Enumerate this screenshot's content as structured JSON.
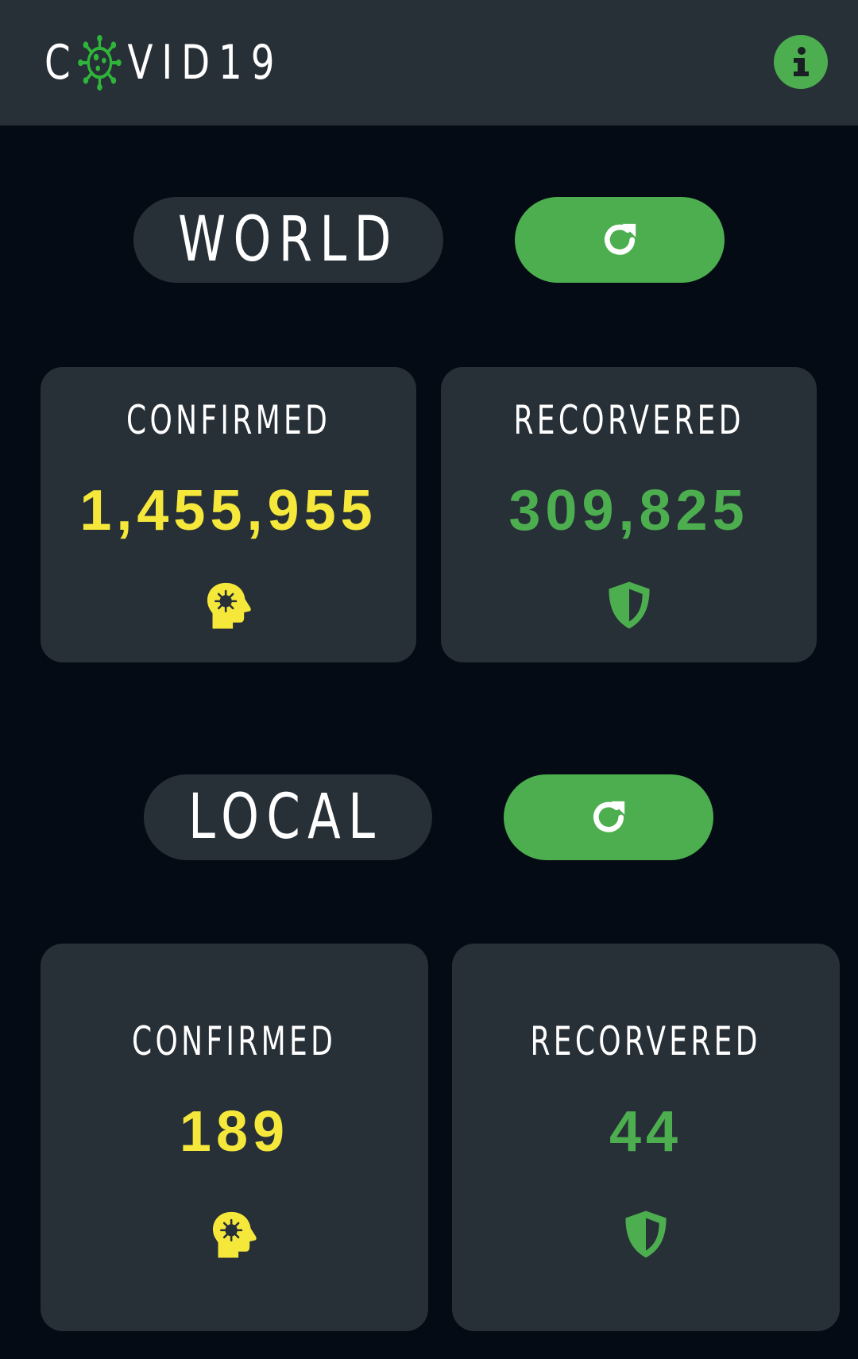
{
  "header": {
    "logo_left": "C",
    "logo_right": "VID19",
    "logo_icon": "virus-icon",
    "info_icon": "info-icon"
  },
  "world": {
    "label": "WORLD",
    "icon": "globe-icon",
    "refresh_icon": "refresh-icon",
    "confirmed": {
      "title": "CONFIRMED",
      "value": "1,455,955",
      "icon": "head-virus-icon"
    },
    "recovered": {
      "title": "RECORVERED",
      "value": "309,825",
      "icon": "shield-icon"
    }
  },
  "local": {
    "label": "LOCAL",
    "icon": "sri-lanka-flag-icon",
    "refresh_icon": "refresh-icon",
    "confirmed": {
      "title": "CONFIRMED",
      "value": "189",
      "icon": "head-virus-icon"
    },
    "recovered": {
      "title": "RECORVERED",
      "value": "44",
      "icon": "shield-icon"
    }
  },
  "colors": {
    "background": "#040b14",
    "surface": "#272f37",
    "accent_green": "#4cae4f",
    "confirmed_yellow": "#f5e83b"
  }
}
